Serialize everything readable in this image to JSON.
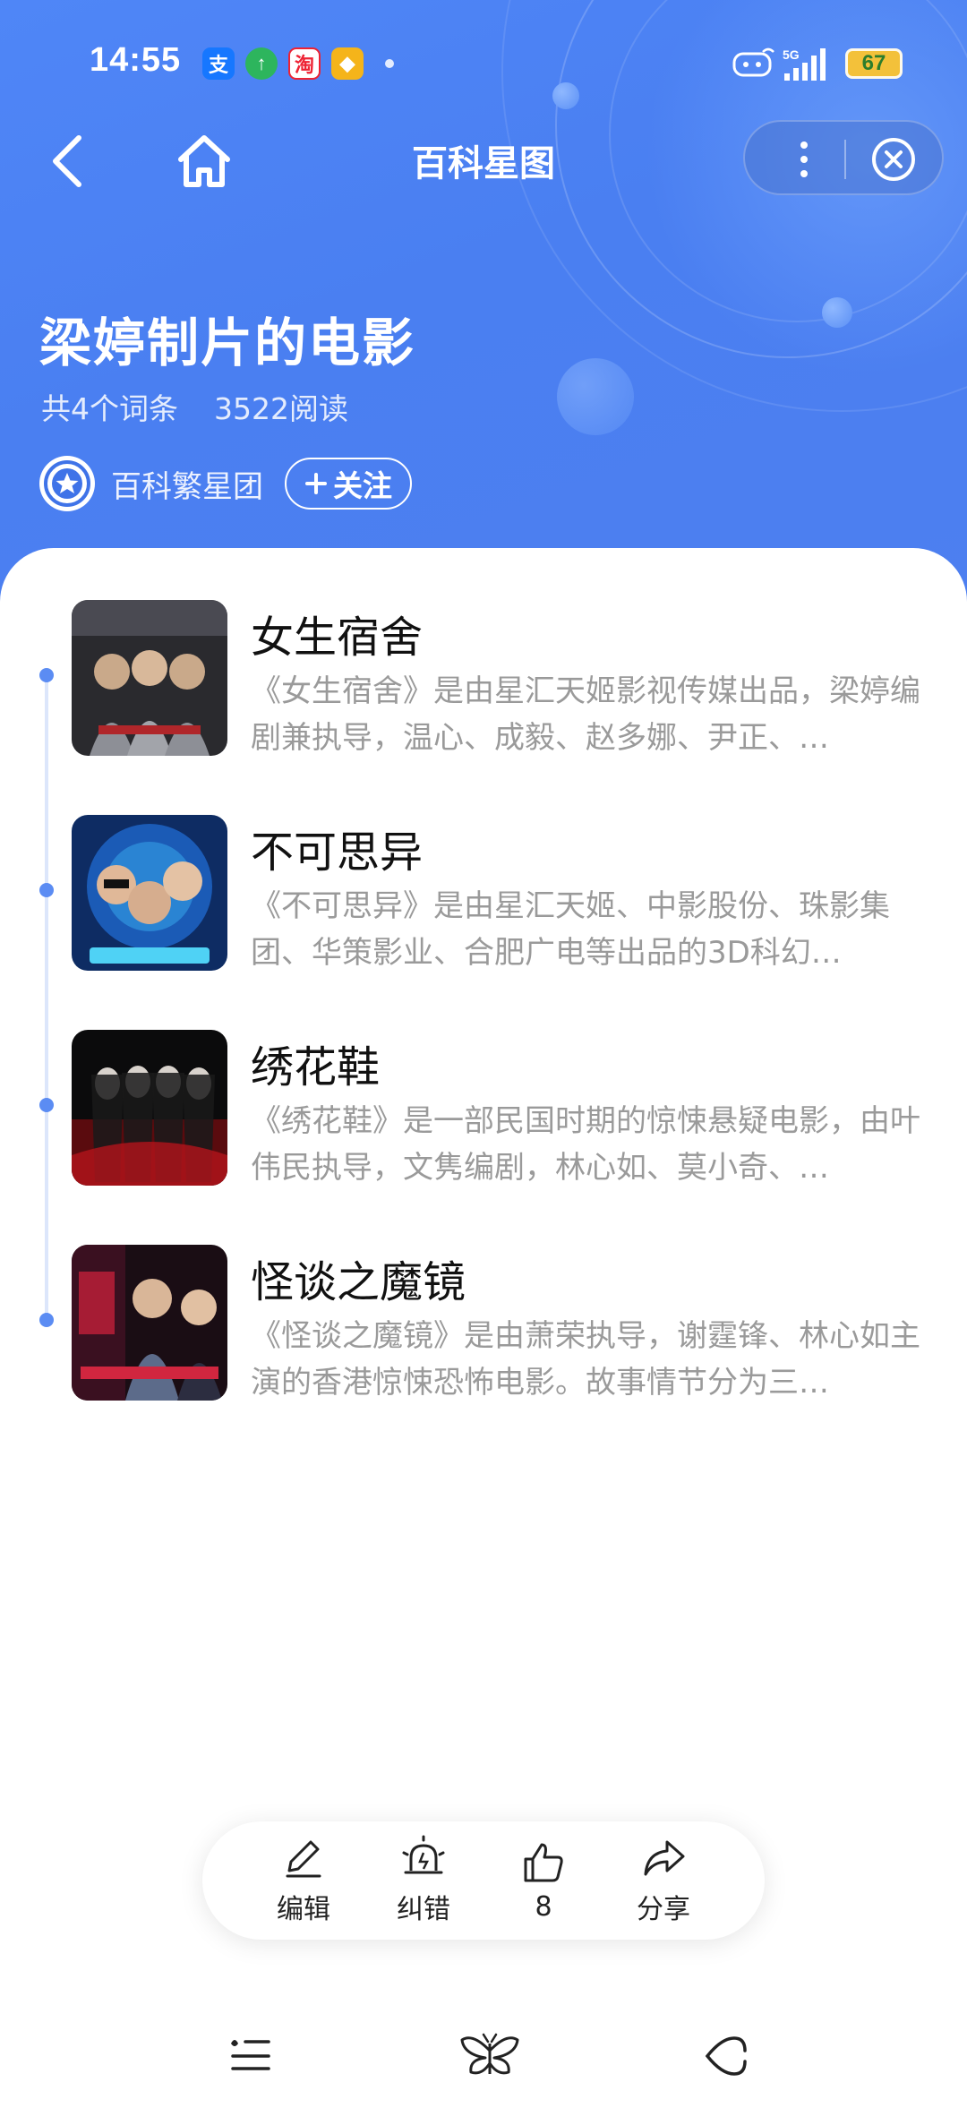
{
  "status_bar": {
    "time": "14:55",
    "battery": "67",
    "icons": [
      "alipay-icon",
      "upgrade-icon",
      "taobao-icon",
      "diamond-icon",
      "robot-icon",
      "signal-5g-icon",
      "battery-icon"
    ]
  },
  "nav": {
    "title": "百科星图"
  },
  "header": {
    "title": "梁婷制片的电影",
    "entry_count": "共4个词条",
    "read_count": "3522阅读",
    "author": "百科繁星团",
    "follow_label": "关注"
  },
  "entries": [
    {
      "title": "女生宿舍",
      "desc": "《女生宿舍》是由星汇天姬影视传媒出品，梁婷编剧兼执导，温心、成毅、赵多娜、尹正、…"
    },
    {
      "title": "不可思异",
      "desc": "《不可思异》是由星汇天姬、中影股份、珠影集团、华策影业、合肥广电等出品的3D科幻…"
    },
    {
      "title": "绣花鞋",
      "desc": "《绣花鞋》是一部民国时期的惊悚悬疑电影，由叶伟民执导，文隽编剧，林心如、莫小奇、…"
    },
    {
      "title": "怪谈之魔镜",
      "desc": "《怪谈之魔镜》是由萧荣执导，谢霆锋、林心如主演的香港惊悚恐怖电影。故事情节分为三…"
    }
  ],
  "actions": {
    "edit": "编辑",
    "report": "纠错",
    "like_count": "8",
    "share": "分享"
  },
  "colors": {
    "header_blue": "#4f86f7",
    "timeline_dot": "#5b8cf3",
    "desc_gray": "#9a9a9a"
  }
}
